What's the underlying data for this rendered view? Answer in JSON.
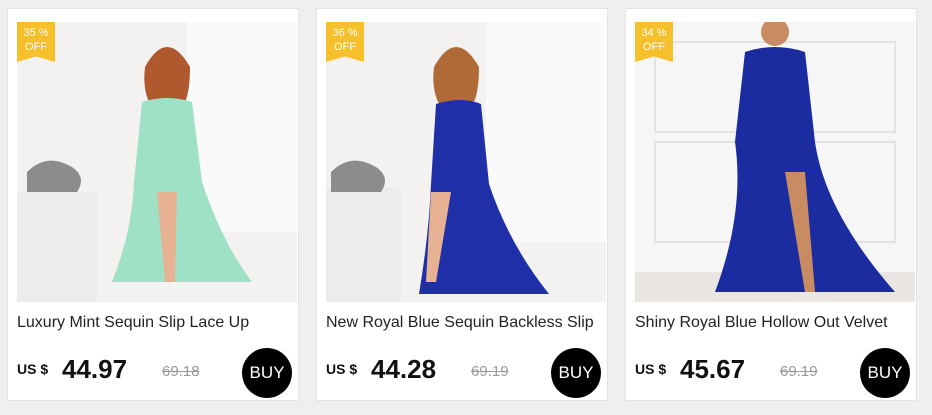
{
  "products": [
    {
      "discount": "35 %\nOFF",
      "title": "Luxury Mint Sequin Slip Lace Up",
      "currency": "US $",
      "price": "44.97",
      "old_price": "69.18",
      "buy_label": "BUY",
      "dress_color": "#9fe1c7"
    },
    {
      "discount": "36 %\nOFF",
      "title": "New Royal Blue Sequin Backless Slip",
      "currency": "US $",
      "price": "44.28",
      "old_price": "69.19",
      "buy_label": "BUY",
      "dress_color": "#1f2fa8"
    },
    {
      "discount": "34 %\nOFF",
      "title": "Shiny Royal Blue Hollow Out Velvet",
      "currency": "US $",
      "price": "45.67",
      "old_price": "69.19",
      "buy_label": "BUY",
      "dress_color": "#1a2ca0"
    }
  ],
  "colors": {
    "badge": "#f6c02a",
    "buy_button": "#000000",
    "old_price": "#999999"
  }
}
